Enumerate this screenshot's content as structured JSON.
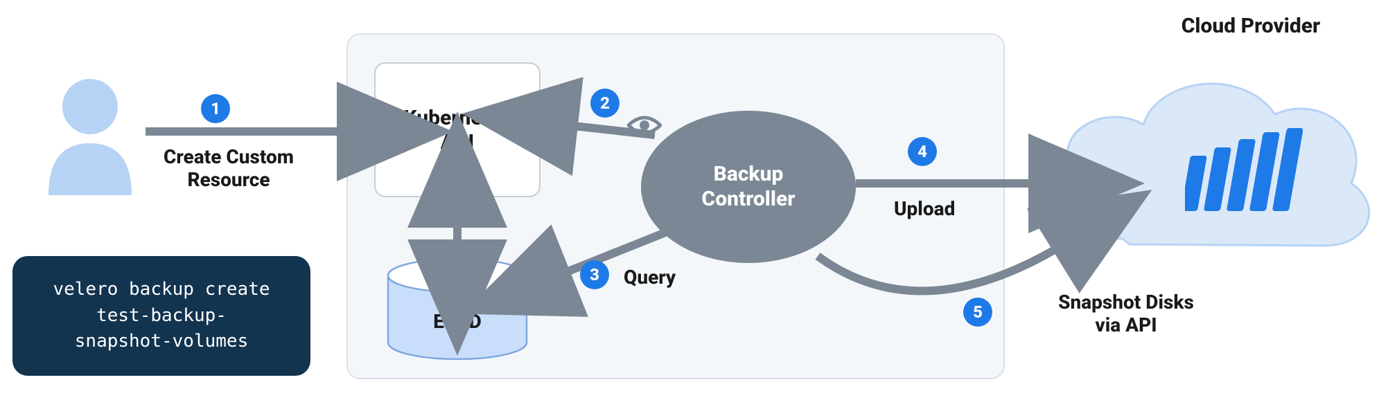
{
  "title": "Cloud Provider",
  "user_label": "Create Custom\nResource",
  "k8s_label": "Kubernetes\nAPI",
  "etcd_label": "ETCD",
  "controller_label": "Backup\nController",
  "query_label": "Query",
  "upload_label": "Upload",
  "snapshot_label": "Snapshot Disks\nvia API",
  "cmd_line1": "velero backup create",
  "cmd_line2": "test-backup-",
  "cmd_line3": "snapshot-volumes",
  "badges": {
    "b1": "1",
    "b2": "2",
    "b3": "3",
    "b4": "4",
    "b5": "5"
  },
  "colors": {
    "badge": "#1e7ae6",
    "user_light": "#b6d3f5",
    "arrow": "#7b8794",
    "cloud_fill": "#dbe8f8",
    "cloud_stroke": "#b6d3f5",
    "etcd_fill": "#c9defa",
    "etcd_stroke": "#7fa8e0"
  }
}
